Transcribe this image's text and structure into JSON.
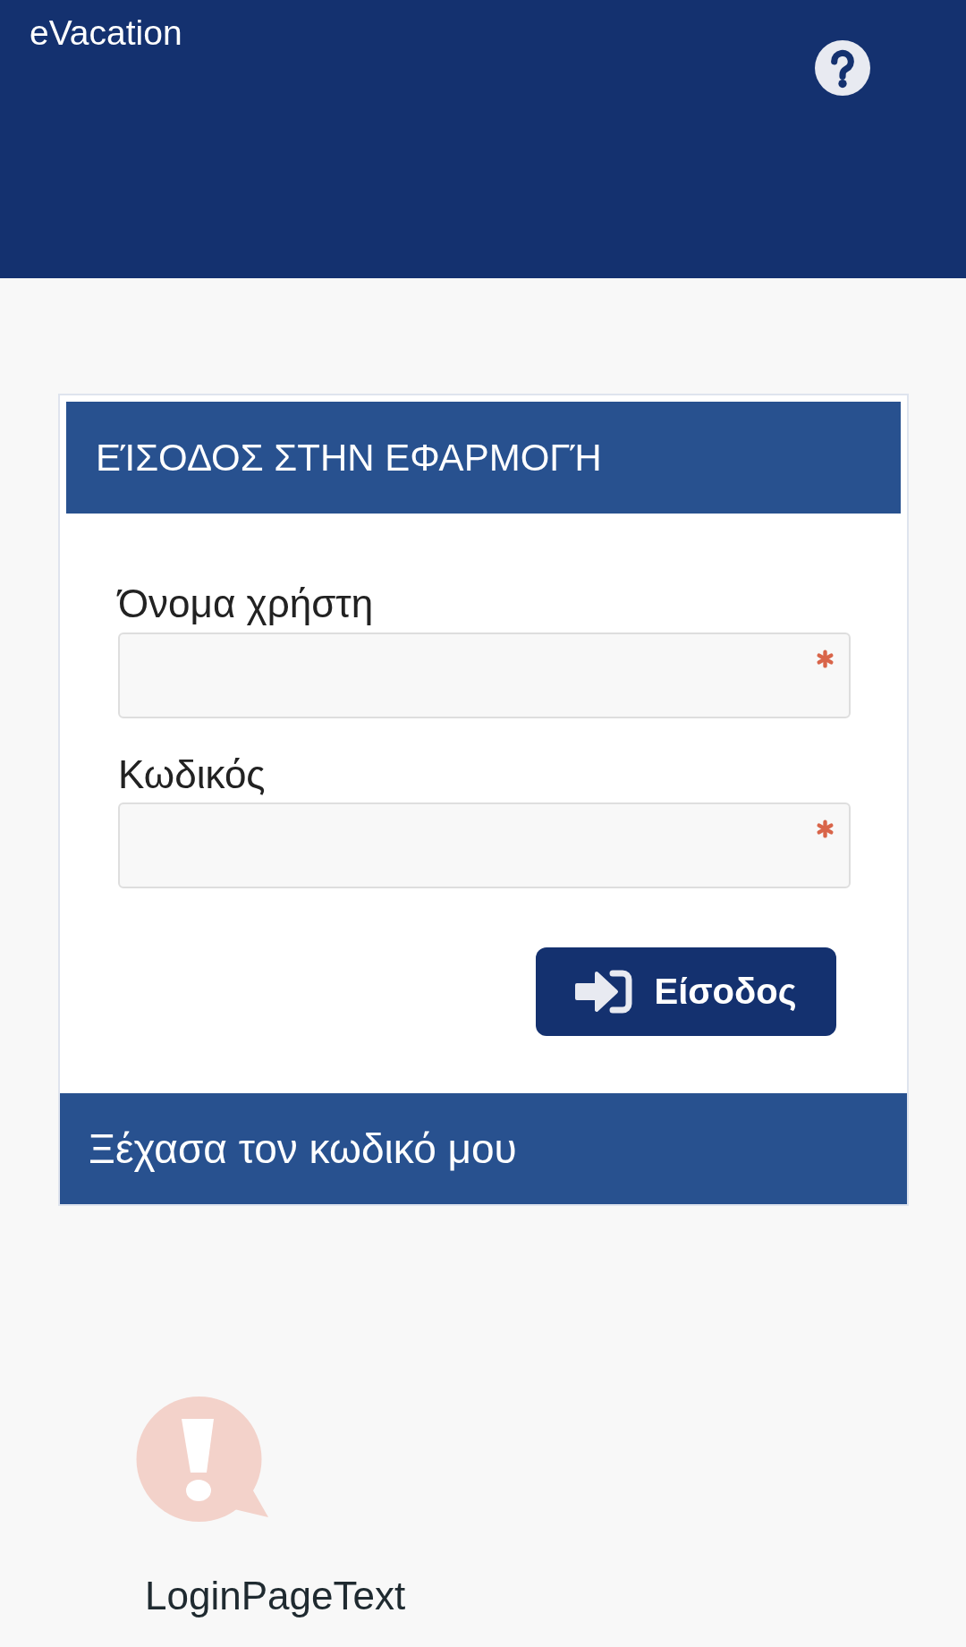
{
  "app_bar": {
    "title": "eVacation"
  },
  "login_card": {
    "title": "ΕΊΣΟΔΟΣ ΣΤΗΝ ΕΦΑΡΜΟΓΉ",
    "fields": [
      {
        "label": "Όνομα χρήστη",
        "required": true
      },
      {
        "label": "Κωδικός",
        "required": true
      }
    ],
    "submit_button": {
      "label": "Είσοδος"
    },
    "forgot_password_link": {
      "label": "Ξέχασα τον κωδικό μου"
    }
  },
  "notice": {
    "text": "LoginPageText"
  }
}
